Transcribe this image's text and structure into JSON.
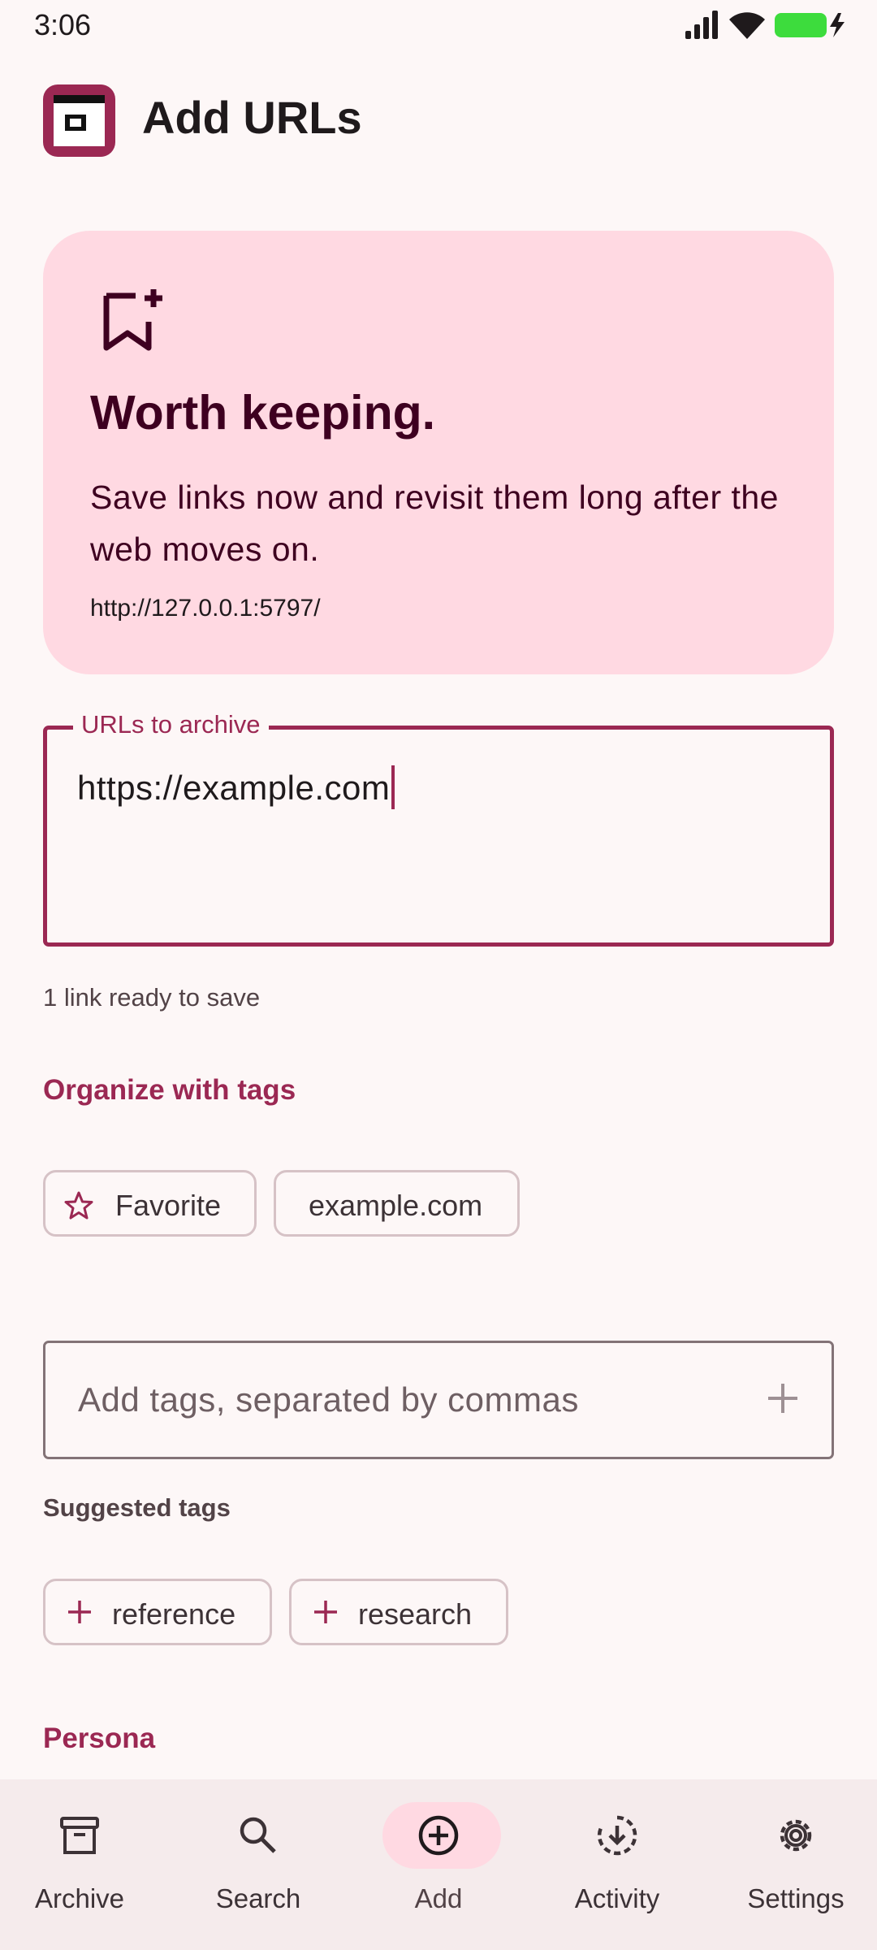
{
  "status_bar": {
    "time": "3:06",
    "icons": [
      "signal-icon",
      "wifi-icon",
      "battery-charging-icon"
    ]
  },
  "header": {
    "title": "Add URLs",
    "logo_icon": "archive-app-logo"
  },
  "hero": {
    "icon": "bookmark-add-icon",
    "title": "Worth keeping.",
    "text": "Save links now and revisit them long after the web moves on.",
    "server_url": "http://127.0.0.1:5797/"
  },
  "url_input": {
    "label": "URLs to archive",
    "value": "https://example.com",
    "helper": "1 link ready to save"
  },
  "tags": {
    "heading": "Organize with tags",
    "chips": [
      {
        "label": "Favorite",
        "icon": "star-outline-icon"
      },
      {
        "label": "example.com",
        "icon": ""
      }
    ],
    "input_placeholder": "Add tags, separated by commas",
    "add_icon": "plus-icon",
    "suggested_heading": "Suggested tags",
    "suggested": [
      {
        "label": "reference",
        "icon": "plus-icon"
      },
      {
        "label": "research",
        "icon": "plus-icon"
      }
    ]
  },
  "persona": {
    "heading": "Persona"
  },
  "bottom_nav": {
    "active": "Add",
    "items": [
      {
        "label": "Archive",
        "icon": "archive-box-icon"
      },
      {
        "label": "Search",
        "icon": "search-icon"
      },
      {
        "label": "Add",
        "icon": "add-circle-icon"
      },
      {
        "label": "Activity",
        "icon": "download-progress-icon"
      },
      {
        "label": "Settings",
        "icon": "gear-icon"
      }
    ]
  },
  "colors": {
    "accent": "#9b2853",
    "hero_background": "#ffd9e2",
    "background": "#fdf7f7",
    "nav_background": "#f5ebec",
    "battery": "#3ddc3d"
  }
}
